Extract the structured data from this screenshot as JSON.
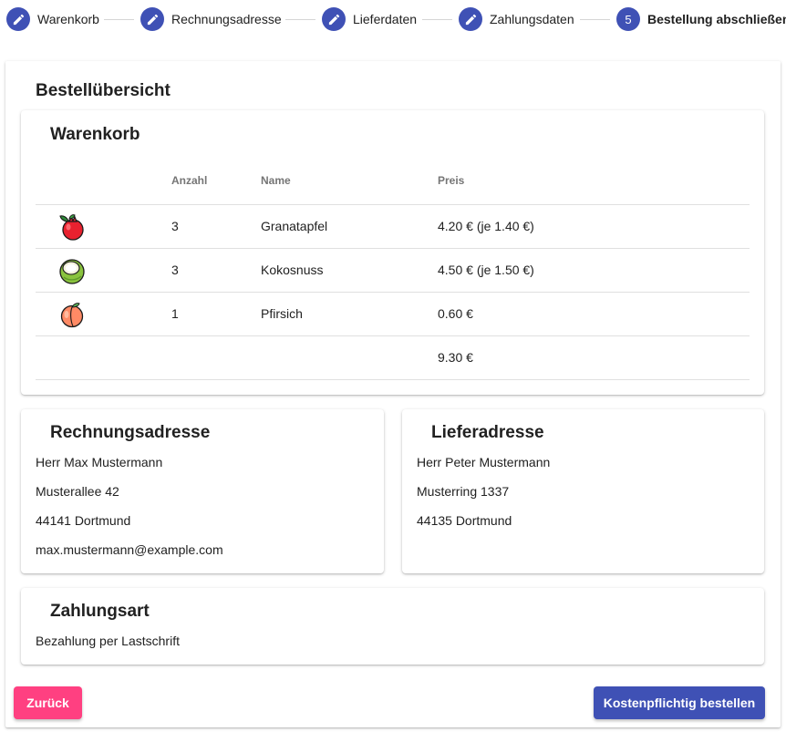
{
  "stepper": {
    "steps": [
      {
        "label": "Warenkorb",
        "icon": "pencil-icon"
      },
      {
        "label": "Rechnungsadresse",
        "icon": "pencil-icon"
      },
      {
        "label": "Lieferdaten",
        "icon": "pencil-icon"
      },
      {
        "label": "Zahlungsdaten",
        "icon": "pencil-icon"
      },
      {
        "label": "Bestellung abschließen",
        "number": "5",
        "active": true
      }
    ],
    "accent_color": "#3f51b5"
  },
  "page": {
    "title": "Bestellübersicht"
  },
  "cart": {
    "title": "Warenkorb",
    "columns": {
      "image": "",
      "anzahl": "Anzahl",
      "name": "Name",
      "preis": "Preis"
    },
    "items": [
      {
        "icon": "pomegranate-icon",
        "anzahl": "3",
        "name": "Granatapfel",
        "preis": "4.20 € (je 1.40 €)"
      },
      {
        "icon": "coconut-icon",
        "anzahl": "3",
        "name": "Kokosnuss",
        "preis": "4.50 € (je 1.50 €)"
      },
      {
        "icon": "peach-icon",
        "anzahl": "1",
        "name": "Pfirsich",
        "preis": "0.60 €"
      }
    ],
    "total": "9.30 €"
  },
  "billing": {
    "title": "Rechnungsadresse",
    "lines": [
      "Herr Max Mustermann",
      "Musterallee 42",
      "44141 Dortmund",
      "max.mustermann@example.com"
    ]
  },
  "shipping": {
    "title": "Lieferadresse",
    "lines": [
      "Herr Peter Mustermann",
      "Musterring 1337",
      "44135 Dortmund"
    ]
  },
  "payment": {
    "title": "Zahlungsart",
    "method": "Bezahlung per Lastschrift"
  },
  "buttons": {
    "back": "Zurück",
    "order": "Kostenpflichtig bestellen",
    "back_color": "#ff4081",
    "order_color": "#3f51b5"
  }
}
